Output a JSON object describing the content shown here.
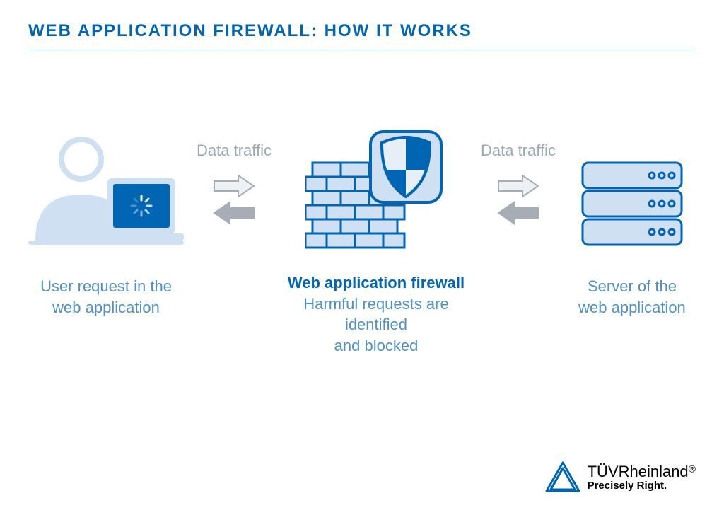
{
  "title": "WEB APPLICATION FIREWALL: HOW IT WORKS",
  "traffic_left": "Data traffic",
  "traffic_right": "Data traffic",
  "user": {
    "line1": "User request in the",
    "line2": "web application"
  },
  "waf": {
    "heading": "Web application firewall",
    "line1": "Harmful requests are identified",
    "line2": "and blocked"
  },
  "server": {
    "line1": "Server of the",
    "line2": "web application"
  },
  "brand": {
    "name1": "TÜV",
    "name2": "Rheinland",
    "reg": "®",
    "slogan": "Precisely Right."
  },
  "colors": {
    "accent": "#0066b3",
    "light": "#cfe0f2",
    "mid": "#4f91c6",
    "gray": "#9aa9b6",
    "arrow_light": "#eef1f4",
    "arrow_dark": "#a7adb4"
  }
}
